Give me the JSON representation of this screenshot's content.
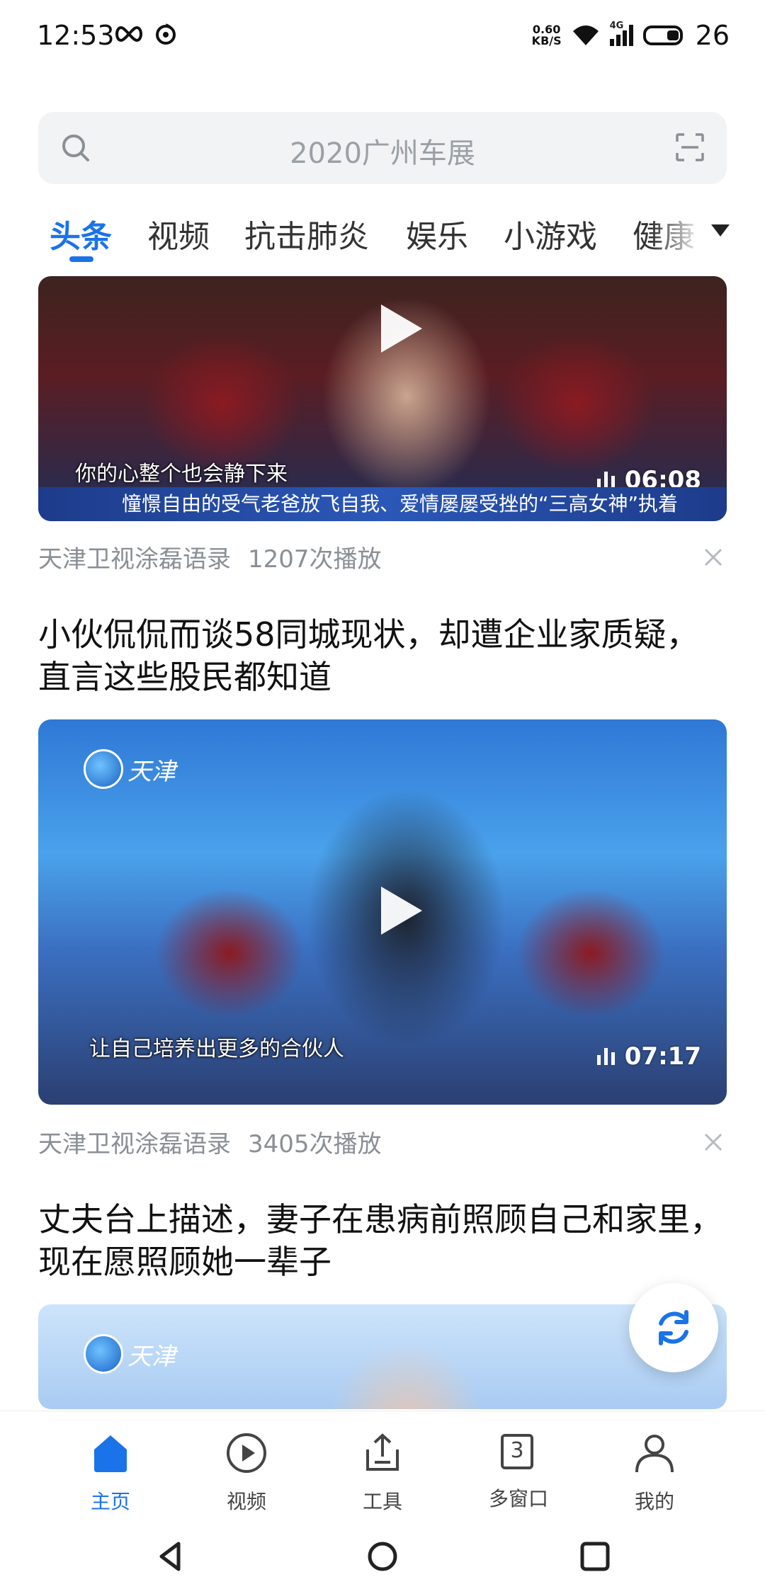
{
  "status_bar": {
    "time": "12:53",
    "net_speed_value": "0.60",
    "net_speed_unit": "KB/S",
    "network_type": "4G",
    "battery": "26"
  },
  "search": {
    "placeholder": "2020广州车展"
  },
  "tabs": [
    {
      "label": "头条",
      "active": true
    },
    {
      "label": "视频"
    },
    {
      "label": "抗击肺炎"
    },
    {
      "label": "娱乐"
    },
    {
      "label": "小游戏"
    },
    {
      "label": "健康"
    }
  ],
  "feed": [
    {
      "caption": "你的心整个也会静下来",
      "ticker": "憧憬自由的受气老爸放飞自我、爱情屡屡受挫的“三高女神”执着",
      "duration": "06:08",
      "source": "天津卫视涂磊语录",
      "plays": "1207次播放"
    },
    {
      "title": "小伙侃侃而谈58同城现状，却遭企业家质疑，直言这些股民都知道",
      "logo": "天津",
      "caption": "让自己培养出更多的合伙人",
      "duration": "07:17",
      "source": "天津卫视涂磊语录",
      "plays": "3405次播放"
    },
    {
      "title": "丈夫台上描述，妻子在患病前照顾自己和家里，现在愿照顾她一辈子",
      "logo": "天津"
    }
  ],
  "bottom_nav": [
    {
      "label": "主页",
      "icon": "home-icon",
      "active": true
    },
    {
      "label": "视频",
      "icon": "play-circle-icon"
    },
    {
      "label": "工具",
      "icon": "tools-icon"
    },
    {
      "label": "多窗口",
      "icon": "windows-icon",
      "count": "3"
    },
    {
      "label": "我的",
      "icon": "user-icon"
    }
  ],
  "colors": {
    "accent": "#1a73e8",
    "meta_text": "#8a8f96",
    "search_bg": "#f2f3f5"
  }
}
